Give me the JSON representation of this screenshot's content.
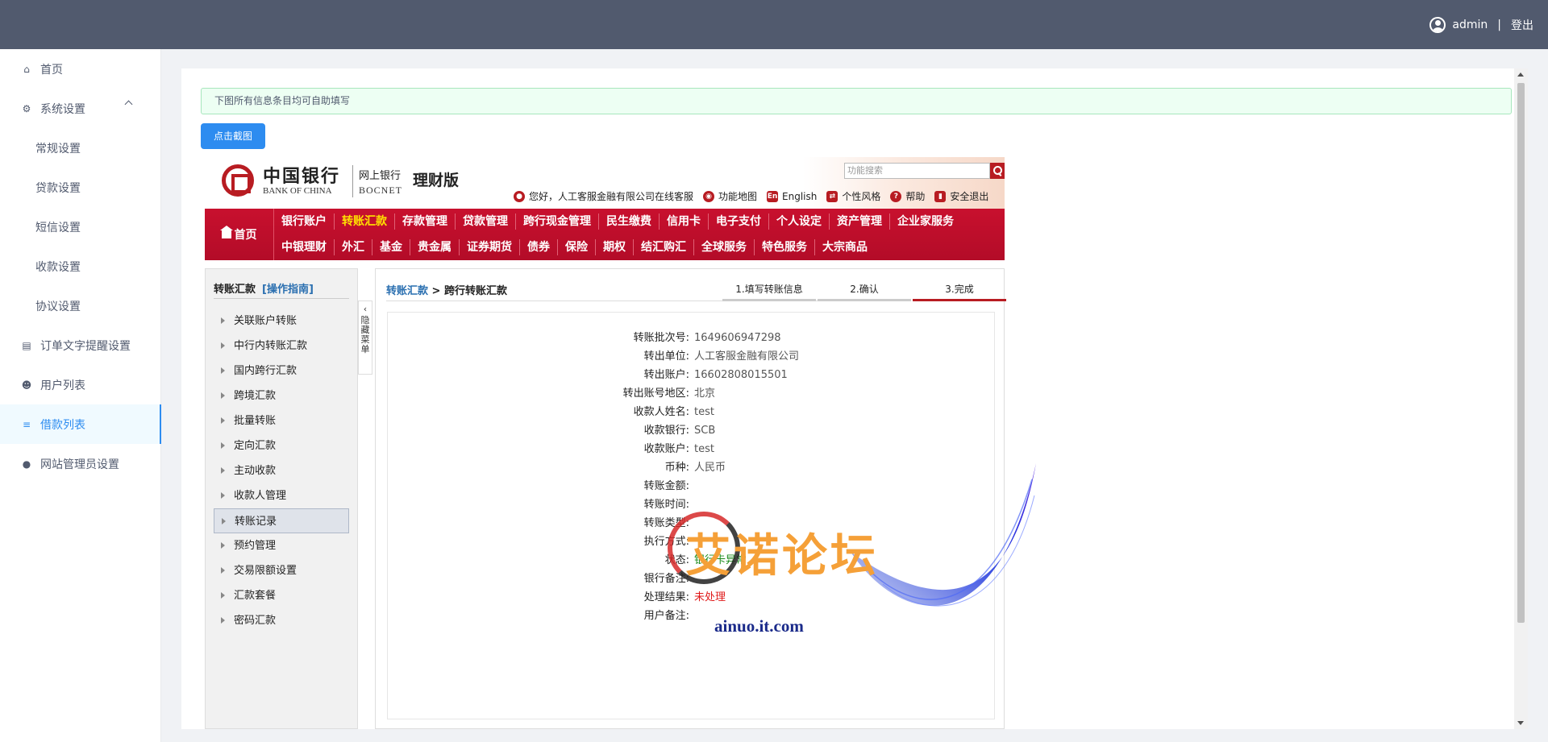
{
  "topbar": {
    "username": "admin",
    "separator": "|",
    "logout": "登出"
  },
  "sidebar": {
    "items": [
      {
        "label": "首页",
        "icon": "home-icon"
      },
      {
        "label": "系统设置",
        "icon": "gear-icon",
        "expanded": true
      },
      {
        "label": "常规设置"
      },
      {
        "label": "贷款设置"
      },
      {
        "label": "短信设置"
      },
      {
        "label": "收款设置"
      },
      {
        "label": "协议设置"
      },
      {
        "label": "订单文字提醒设置",
        "icon": "document-icon"
      },
      {
        "label": "用户列表",
        "icon": "users-icon"
      },
      {
        "label": "借款列表",
        "icon": "list-icon",
        "active": true
      },
      {
        "label": "网站管理员设置",
        "icon": "user-icon"
      }
    ]
  },
  "main": {
    "alert": "下图所有信息条目均可自助填写",
    "screenshot_button": "点击截图"
  },
  "bank": {
    "logo_cn": "中国银行",
    "logo_en": "BANK OF CHINA",
    "wy_cn": "网上银行",
    "wy_en": "BOCNET",
    "edition": "理财版",
    "search_placeholder": "功能搜索",
    "tools": {
      "greeting": "您好，人工客服金融有限公司",
      "service": "在线客服",
      "map": "功能地图",
      "english": "English",
      "style": "个性风格",
      "help": "帮助",
      "logout": "安全退出"
    },
    "nav_home": "首页",
    "nav_row1": [
      "银行账户",
      "转账汇款",
      "存款管理",
      "贷款管理",
      "跨行现金管理",
      "民生缴费",
      "信用卡",
      "电子支付",
      "个人设定",
      "资产管理",
      "企业家服务"
    ],
    "nav_row2": [
      "中银理财",
      "外汇",
      "基金",
      "贵金属",
      "证券期货",
      "债券",
      "保险",
      "期权",
      "结汇购汇",
      "全球服务",
      "特色服务",
      "大宗商品"
    ],
    "left": {
      "title": "转账汇款",
      "guide": "[操作指南]",
      "items": [
        "关联账户转账",
        "中行内转账汇款",
        "国内跨行汇款",
        "跨境汇款",
        "批量转账",
        "定向汇款",
        "主动收款",
        "收款人管理",
        "转账记录",
        "预约管理",
        "交易限额设置",
        "汇款套餐",
        "密码汇款"
      ],
      "hide_tab": "隐藏菜单"
    },
    "crumb_link": "转账汇款",
    "crumb_current": "跨行转账汇款",
    "steps": [
      "1.填写转账信息",
      "2.确认",
      "3.完成"
    ],
    "fields": [
      {
        "k": "转账批次号:",
        "v": "1649606947298"
      },
      {
        "k": "转出单位:",
        "v": "人工客服金融有限公司"
      },
      {
        "k": "转出账户:",
        "v": "16602808015501"
      },
      {
        "k": "转出账号地区:",
        "v": "北京"
      },
      {
        "k": "收款人姓名:",
        "v": "test"
      },
      {
        "k": "收款银行:",
        "v": "SCB"
      },
      {
        "k": "收款账户:",
        "v": "test"
      },
      {
        "k": "币种:",
        "v": "人民币"
      },
      {
        "k": "转账金额:",
        "v": ""
      },
      {
        "k": "转账时间:",
        "v": ""
      },
      {
        "k": "转账类型:",
        "v": ""
      },
      {
        "k": "执行方式:",
        "v": ""
      },
      {
        "k": "状态:",
        "v": "银行卡异常"
      },
      {
        "k": "银行备注:",
        "v": ""
      },
      {
        "k": "处理结果:",
        "v": "未处理"
      },
      {
        "k": "用户备注:",
        "v": ""
      }
    ]
  },
  "watermark": {
    "text": "艾诺论坛",
    "url": "ainuo.it.com"
  }
}
